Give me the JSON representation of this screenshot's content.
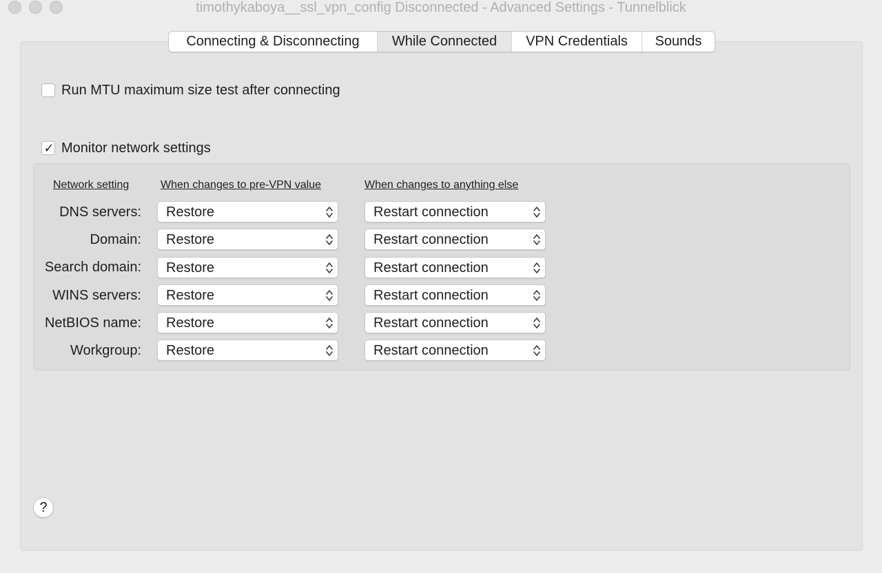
{
  "window": {
    "title": "timothykaboya__ssl_vpn_config Disconnected - Advanced Settings - Tunnelblick"
  },
  "tabs": [
    {
      "label": "Connecting & Disconnecting",
      "selected": false
    },
    {
      "label": "While Connected",
      "selected": true
    },
    {
      "label": "VPN Credentials",
      "selected": false
    },
    {
      "label": "Sounds",
      "selected": false
    }
  ],
  "mtu_test": {
    "label": "Run MTU maximum size test after connecting",
    "checked": false
  },
  "monitor": {
    "label": "Monitor network settings",
    "checked": true,
    "check_glyph": "✓"
  },
  "network_table": {
    "headers": {
      "setting": "Network setting",
      "pre_vpn": "When changes to pre-VPN value",
      "anything_else": "When changes to anything else"
    },
    "rows": [
      {
        "label": "DNS servers:",
        "pre_vpn": "Restore",
        "anything_else": "Restart connection"
      },
      {
        "label": "Domain:",
        "pre_vpn": "Restore",
        "anything_else": "Restart connection"
      },
      {
        "label": "Search domain:",
        "pre_vpn": "Restore",
        "anything_else": "Restart connection"
      },
      {
        "label": "WINS servers:",
        "pre_vpn": "Restore",
        "anything_else": "Restart connection"
      },
      {
        "label": "NetBIOS name:",
        "pre_vpn": "Restore",
        "anything_else": "Restart connection"
      },
      {
        "label": "Workgroup:",
        "pre_vpn": "Restore",
        "anything_else": "Restart connection"
      }
    ]
  },
  "help": {
    "label": "?"
  }
}
